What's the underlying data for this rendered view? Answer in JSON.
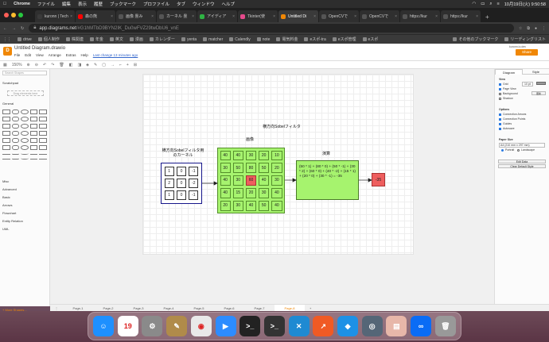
{
  "menubar": {
    "app": "Chrome",
    "items": [
      "ファイル",
      "編集",
      "表示",
      "履歴",
      "ブックマーク",
      "プロファイル",
      "タブ",
      "ウィンドウ",
      "ヘルプ"
    ],
    "clock": "10月19日(火)  9:50:58"
  },
  "tabs": [
    {
      "label": "kuronn | Tech",
      "color": "#3a3a3a"
    },
    {
      "label": "森の熊",
      "color": "#ff0000"
    },
    {
      "label": "画像 畳み",
      "color": "#555"
    },
    {
      "label": "カーネル 畳",
      "color": "#555"
    },
    {
      "label": "アイディア",
      "color": "#2fb344"
    },
    {
      "label": "Tkinter(使",
      "color": "#e64a8c"
    },
    {
      "label": "Untitled Di",
      "color": "#f08705",
      "active": true
    },
    {
      "label": "OpenCVで",
      "color": "#555"
    },
    {
      "label": "OpenCVで",
      "color": "#555"
    },
    {
      "label": "https://kur",
      "color": "#555"
    },
    {
      "label": "https://kur",
      "color": "#555"
    }
  ],
  "address": {
    "host": "app.diagrams.net",
    "rest": "/#G1hMTbD9BYN2IK_Du0wFVZ29twDbU6_vnE"
  },
  "bookmarks": [
    "drive",
    "個人制作",
    "株関連",
    "年金",
    "英文",
    "漫画",
    "カレンダー",
    "yenta",
    "matcher",
    "Calendly",
    "note",
    "電気料金",
    "eスポ-tra",
    "eスポ管理",
    "eスポ",
    "その他のブックマーク",
    "リーディングリスト"
  ],
  "app": {
    "logo": "D",
    "title": "Untitled Diagram.drawio",
    "menus": [
      "File",
      "Edit",
      "View",
      "Arrange",
      "Extras",
      "Help"
    ],
    "lastchange": "Last change 13 minutes ago",
    "share": "Share",
    "user": "kuronn.io.dev",
    "zoom": "150%"
  },
  "left": {
    "search_placeholder": "Search Shapes",
    "scratchpad": "Scratchpad",
    "drag": "Drag elements here",
    "general": "General",
    "sections": [
      "Misc",
      "Advanced",
      "Basic",
      "Arrows",
      "Flowchart",
      "Entity Relation",
      "UML"
    ],
    "more": "+ More Shapes..."
  },
  "right": {
    "tab_diagram": "Diagram",
    "tab_style": "Style",
    "view": "View",
    "grid": "Grid",
    "gridsize": "10 pt",
    "pageview": "Page View",
    "background": "Background",
    "shadow": "Shadow",
    "options": "Options",
    "opts": [
      "Connection Arrows",
      "Connection Points",
      "Guides",
      "Autosave"
    ],
    "papersize": "Paper Size",
    "paper": "A4 (210 mm x 297 mm)",
    "portrait": "Portrait",
    "landscape": "Landscape",
    "edit": "Edit Data",
    "clearstyle": "Clear Default Style"
  },
  "pages": [
    "Page-1",
    "Page-2",
    "Page-3",
    "Page-4",
    "Page-5",
    "Page-6",
    "Page-7",
    "Page-8"
  ],
  "diagram": {
    "title": "横方向Sobelフィルタ",
    "image_label": "画像",
    "kernel_label": "横方向Sobelフィルタ用\nのカーネル",
    "calc_label": "演算",
    "kernel": [
      "1",
      "0",
      "-1",
      "2",
      "0",
      "-2",
      "1",
      "0",
      "-1"
    ],
    "image": [
      "40",
      "40",
      "30",
      "20",
      "10",
      "30",
      "50",
      "80",
      "50",
      "20",
      "40",
      "30",
      "60",
      "40",
      "30",
      "40",
      "15",
      "20",
      "30",
      "40",
      "20",
      "30",
      "40",
      "50",
      "40"
    ],
    "highlight_index": 12,
    "formula": "(50 * 1) + (80 * 0) + (50 * -1) + (30 * 2) + (60 * 0) + (40 * -2) + (15 * 1) + (20 * 0) + (30 * -1) = -35",
    "result": "-35"
  },
  "dock": [
    {
      "name": "finder-icon",
      "g": "☺",
      "c": "#1e90ff"
    },
    {
      "name": "calendar-icon",
      "g": "19",
      "c": "#ffffff"
    },
    {
      "name": "system-preferences-icon",
      "g": "⚙",
      "c": "#8a8a8a"
    },
    {
      "name": "notes-app-icon",
      "g": "✎",
      "c": "#b08b4a"
    },
    {
      "name": "chrome-icon",
      "g": "◉",
      "c": "#e9e9e9"
    },
    {
      "name": "zoom-icon",
      "g": "▶",
      "c": "#2d8cff"
    },
    {
      "name": "terminal-icon",
      "g": ">_",
      "c": "#222"
    },
    {
      "name": "terminal2-icon",
      "g": ">_",
      "c": "#333"
    },
    {
      "name": "vscode-icon",
      "g": "✕",
      "c": "#1f8ad2"
    },
    {
      "name": "drawio-app-icon",
      "g": "↗",
      "c": "#f05a24"
    },
    {
      "name": "docker-icon",
      "g": "◆",
      "c": "#1d91e6"
    },
    {
      "name": "camera-icon",
      "g": "◎",
      "c": "#556677"
    },
    {
      "name": "preview-icon",
      "g": "▤",
      "c": "#e7b7a9"
    },
    {
      "name": "infinity-icon",
      "g": "∞",
      "c": "#0a6cf5"
    },
    {
      "name": "trash-icon",
      "g": "🗑",
      "c": "#999"
    }
  ]
}
